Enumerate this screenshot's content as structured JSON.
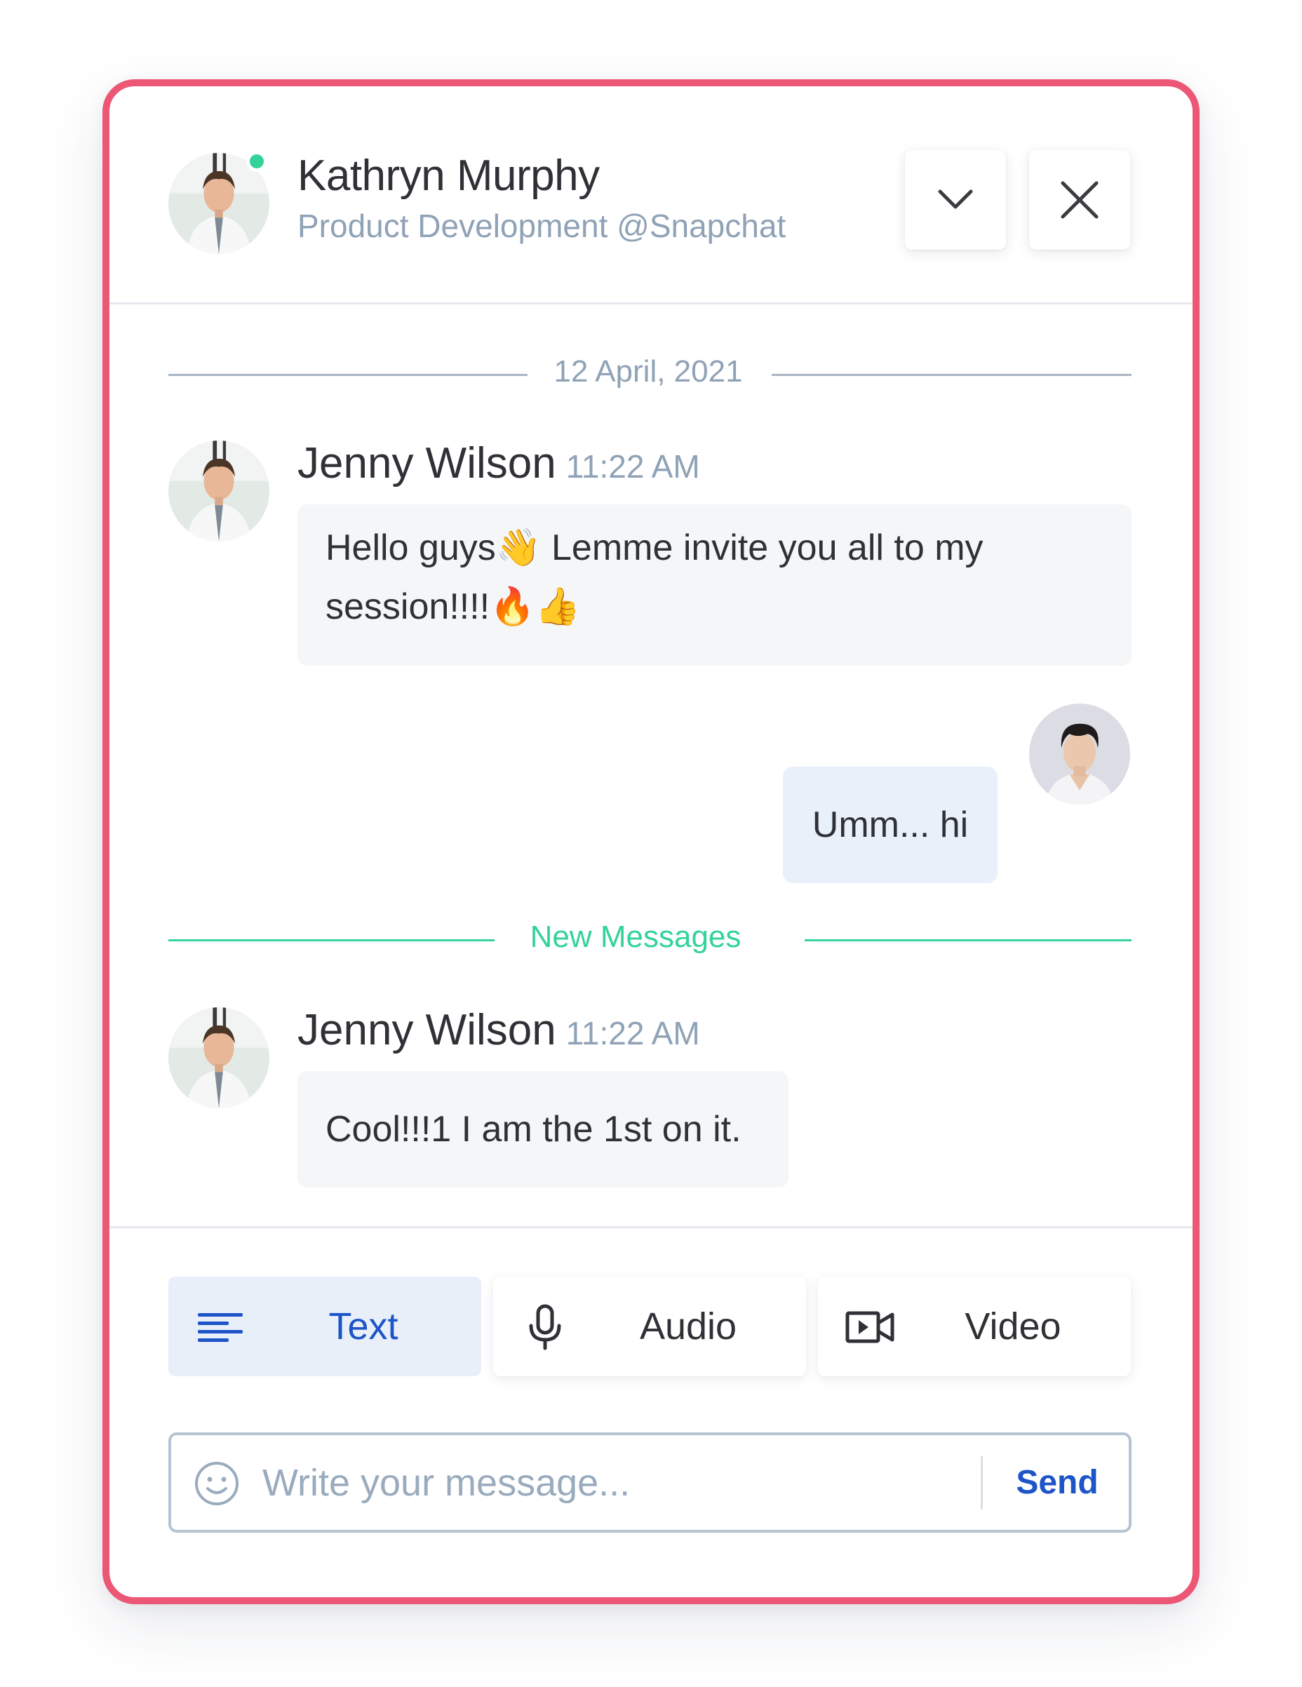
{
  "header": {
    "name": "Kathryn Murphy",
    "subtitle": "Product Development @Snapchat",
    "status": "online",
    "collapse_icon": "chevron-down-icon",
    "close_icon": "close-icon"
  },
  "conversation": {
    "date_separator": "12 April, 2021",
    "new_messages_label": "New Messages",
    "messages": [
      {
        "author": "Jenny Wilson",
        "time": "11:22 AM",
        "line1": "Hello guys👋 Lemme invite you all to my",
        "line2": "session!!!!🔥👍"
      },
      {
        "self": true,
        "text": "Umm... hi"
      },
      {
        "author": "Jenny Wilson",
        "time": "11:22 AM",
        "text": "Cool!!!1 I am the 1st on it."
      }
    ]
  },
  "composer": {
    "modes": [
      {
        "label": "Text",
        "icon": "text-lines-icon",
        "active": true
      },
      {
        "label": "Audio",
        "icon": "microphone-icon",
        "active": false
      },
      {
        "label": "Video",
        "icon": "video-camera-icon",
        "active": false
      }
    ],
    "placeholder": "Write your message...",
    "value": "",
    "send_label": "Send",
    "emoji_icon": "smiley-icon"
  },
  "colors": {
    "frame_border": "#ec5775",
    "online": "#34d399",
    "new_messages": "#34d399",
    "accent_blue": "#1d54c8",
    "muted_text": "#8fa2b6",
    "bubble_other": "#f5f6f8",
    "bubble_self": "#e8f1f9"
  }
}
